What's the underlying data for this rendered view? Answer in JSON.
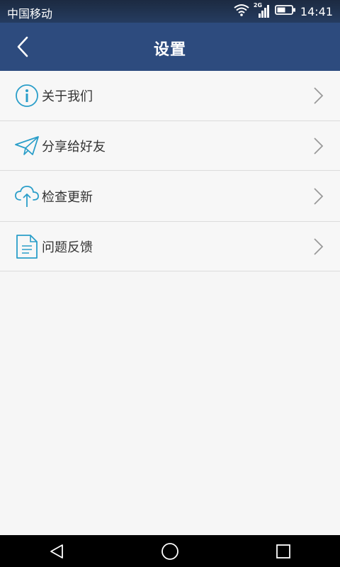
{
  "status_bar": {
    "carrier": "中国移动",
    "network": "2G",
    "time": "14:41"
  },
  "app_bar": {
    "title": "设置"
  },
  "settings_items": [
    {
      "label": "关于我们",
      "icon": "info-icon"
    },
    {
      "label": "分享给好友",
      "icon": "paper-plane-icon"
    },
    {
      "label": "检查更新",
      "icon": "cloud-upload-icon"
    },
    {
      "label": "问题反馈",
      "icon": "document-icon"
    }
  ],
  "colors": {
    "app_bar": "#2d4b7e",
    "accent_icon": "#2a9ec9",
    "background": "#f6f6f6",
    "divider": "#dcdcdc"
  }
}
